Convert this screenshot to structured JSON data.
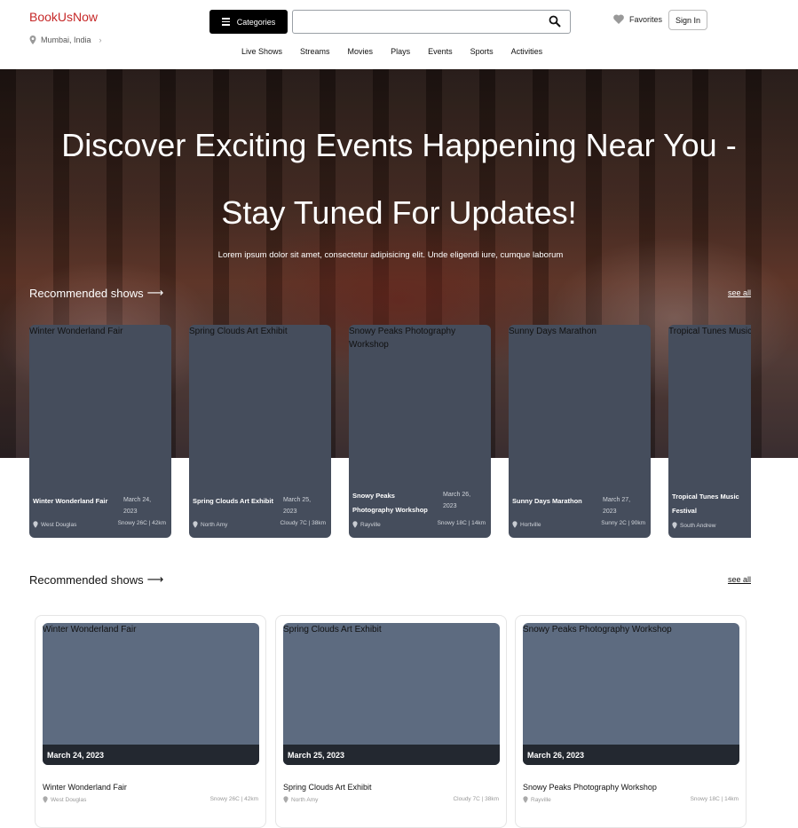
{
  "header": {
    "brand": "BookUsNow",
    "location": "Mumbai, India",
    "categories_label": "Categories",
    "search_placeholder": "",
    "favorites_label": "Favorites",
    "signin_label": "Sign In",
    "nav": [
      "Live Shows",
      "Streams",
      "Movies",
      "Plays",
      "Events",
      "Sports",
      "Activities"
    ]
  },
  "hero": {
    "title_line1": "Discover Exciting Events Happening Near You -",
    "title_line2": "Stay Tuned For Updates!",
    "subtitle": "Lorem ipsum dolor sit amet, consectetur adipisicing elit. Unde eligendi iure, cumque laborum"
  },
  "section1": {
    "title": "Recommended shows",
    "arrow": "⟶",
    "see_all": "see all"
  },
  "carousel": [
    {
      "alt": "Winter Wonderland Fair",
      "name": "Winter Wonderland Fair",
      "date": "March 24, 2023",
      "location": "West Douglas",
      "weather": "Snowy 26C | 42km"
    },
    {
      "alt": "Spring Clouds Art Exhibit",
      "name": "Spring Clouds Art Exhibit",
      "date": "March 25, 2023",
      "location": "North Amy",
      "weather": "Cloudy 7C | 38km"
    },
    {
      "alt": "Snowy Peaks Photography Workshop",
      "name": "Snowy Peaks Photography Workshop",
      "date": "March 26, 2023",
      "location": "Rayville",
      "weather": "Snowy 18C | 14km"
    },
    {
      "alt": "Sunny Days Marathon",
      "name": "Sunny Days Marathon",
      "date": "March 27, 2023",
      "location": "Hortville",
      "weather": "Sunny 2C | 90km"
    },
    {
      "alt": "Tropical Tunes Music Festival",
      "name": "Tropical Tunes Music Festival",
      "date": "",
      "location": "South Andrew",
      "weather": ""
    }
  ],
  "section2": {
    "title": "Recommended shows",
    "arrow": "⟶",
    "see_all": "see all"
  },
  "grid": [
    {
      "alt": "Winter Wonderland Fair",
      "date": "March 24, 2023",
      "name": "Winter Wonderland Fair",
      "location": "West Douglas",
      "weather": "Snowy 26C | 42km"
    },
    {
      "alt": "Spring Clouds Art Exhibit",
      "date": "March 25, 2023",
      "name": "Spring Clouds Art Exhibit",
      "location": "North Amy",
      "weather": "Cloudy 7C | 38km"
    },
    {
      "alt": "Snowy Peaks Photography Workshop",
      "date": "March 26, 2023",
      "name": "Snowy Peaks Photography Workshop",
      "location": "Rayville",
      "weather": "Snowy 18C | 14km"
    }
  ],
  "colors": {
    "brand": "#c62828",
    "card_dark": "#454d5c",
    "card_image": "#5d6b80"
  }
}
